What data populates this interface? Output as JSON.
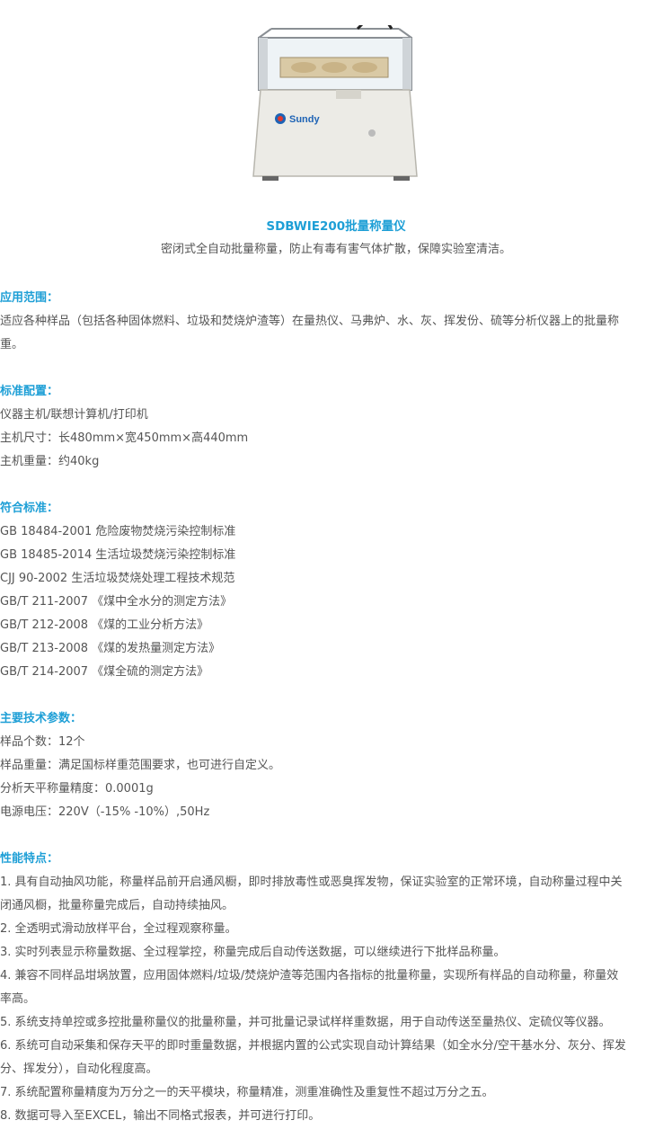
{
  "header": {
    "title": "SDBWIE200批量称量仪",
    "subtitle": "密闭式全自动批量称量，防止有毒有害气体扩散，保障实验室清洁。",
    "brand": "Sundy"
  },
  "sections": {
    "scope": {
      "heading": "应用范围：",
      "lines": [
        "适应各种样品（包括各种固体燃料、垃圾和焚烧炉渣等）在量热仪、马弗炉、水、灰、挥发份、硫等分析仪器上的批量称",
        "重。"
      ]
    },
    "config": {
      "heading": "标准配置：",
      "lines": [
        "仪器主机/联想计算机/打印机",
        "主机尺寸：长480mm×宽450mm×高440mm",
        "主机重量：约40kg"
      ]
    },
    "standards": {
      "heading": "符合标准：",
      "lines": [
        "GB 18484-2001 危险废物焚烧污染控制标准",
        "GB 18485-2014 生活垃圾焚烧污染控制标准",
        "CJJ 90-2002 生活垃圾焚烧处理工程技术规范",
        "GB/T 211-2007 《煤中全水分的测定方法》",
        "GB/T 212-2008 《煤的工业分析方法》",
        "GB/T 213-2008 《煤的发热量测定方法》",
        "GB/T 214-2007 《煤全硫的测定方法》"
      ]
    },
    "params": {
      "heading": "主要技术参数：",
      "lines": [
        "样品个数：12个",
        "样品重量：满足国标样重范围要求，也可进行自定义。",
        "分析天平称量精度：0.0001g",
        "电源电压：220V（-15% -10%）,50Hz"
      ]
    },
    "features": {
      "heading": "性能特点：",
      "lines": [
        "1. 具有自动抽风功能，称量样品前开启通风橱，即时排放毒性或恶臭挥发物，保证实验室的正常环境，自动称量过程中关",
        "闭通风橱，批量称量完成后，自动持续抽风。",
        "2. 全透明式滑动放样平台，全过程观察称量。",
        "3. 实时列表显示称量数据、全过程掌控，称量完成后自动传送数据，可以继续进行下批样品称量。",
        "4. 兼容不同样品坩埚放置，应用固体燃料/垃圾/焚烧炉渣等范围内各指标的批量称量，实现所有样品的自动称量，称量效",
        "率高。",
        "5. 系统支持单控或多控批量称量仪的批量称量，并可批量记录试样样重数据，用于自动传送至量热仪、定硫仪等仪器。",
        "6. 系统可自动采集和保存天平的即时重量数据，并根据内置的公式实现自动计算结果（如全水分/空干基水分、灰分、挥发",
        "分、挥发分），自动化程度高。",
        "7. 系统配置称量精度为万分之一的天平模块，称量精准，测重准确性及重复性不超过万分之五。",
        "8. 数据可导入至EXCEL，输出不同格式报表，并可进行打印。"
      ]
    }
  },
  "colors": {
    "accent": "#1e9fd6",
    "text": "#555555"
  }
}
